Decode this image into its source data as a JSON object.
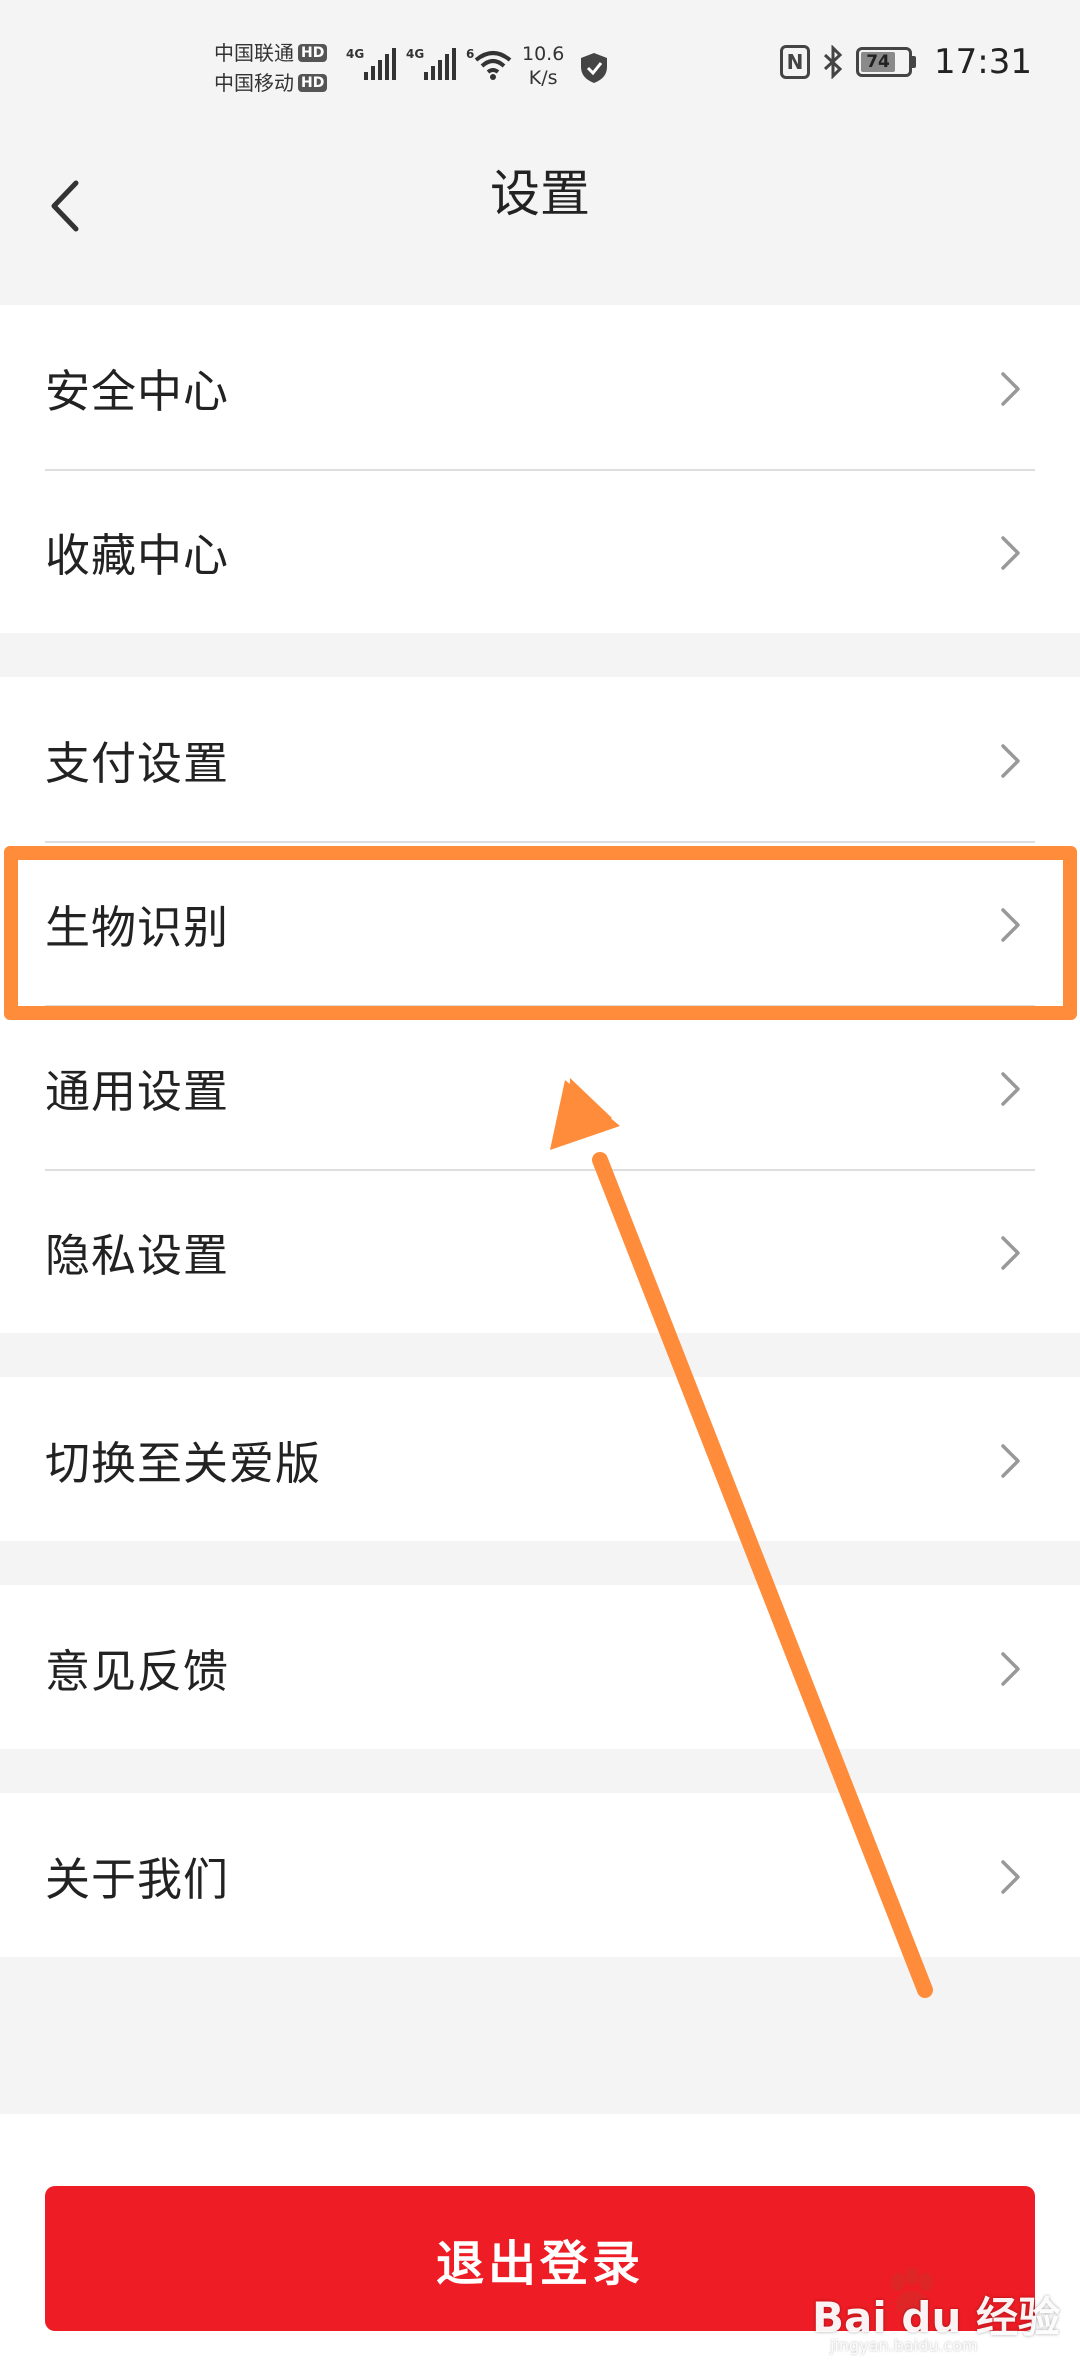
{
  "status_bar": {
    "carrier_1": "中国联通",
    "carrier_2": "中国移动",
    "hd_label": "HD",
    "net_1": "4G",
    "net_2": "4G",
    "wifi_label": "6",
    "speed_value": "10.6",
    "speed_unit": "K/s",
    "nfc": "N",
    "battery": "74",
    "battery_level": 0.74,
    "time": "17:31"
  },
  "header": {
    "title": "设置"
  },
  "groups": [
    {
      "items": [
        {
          "label": "安全中心"
        },
        {
          "label": "收藏中心"
        }
      ]
    },
    {
      "items": [
        {
          "label": "支付设置"
        },
        {
          "label": "生物识别"
        },
        {
          "label": "通用设置"
        },
        {
          "label": "隐私设置"
        }
      ]
    },
    {
      "items": [
        {
          "label": "切换至关爱版"
        }
      ]
    },
    {
      "items": [
        {
          "label": "意见反馈"
        }
      ]
    },
    {
      "items": [
        {
          "label": "关于我们"
        }
      ]
    }
  ],
  "logout": {
    "label": "退出登录"
  },
  "annotation": {
    "highlighted_item": "生物识别",
    "color": "#ff8c3a"
  },
  "watermark": {
    "text": "Bai du 经验",
    "sub": "jingyan.baidu.com"
  },
  "colors": {
    "accent": "#ee1c24",
    "background": "#f4f4f4"
  }
}
